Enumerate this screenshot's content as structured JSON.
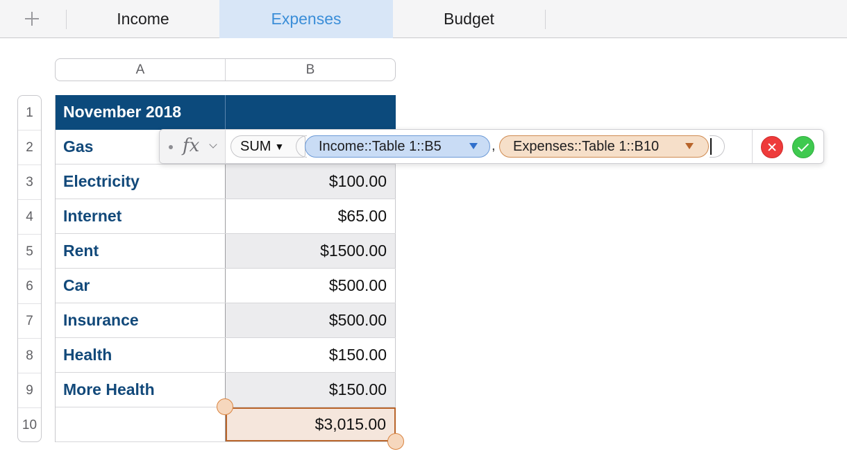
{
  "tabs": {
    "add_icon": "plus-icon",
    "items": [
      {
        "label": "Income",
        "active": false
      },
      {
        "label": "Expenses",
        "active": true
      },
      {
        "label": "Budget",
        "active": false
      }
    ]
  },
  "columns": [
    "A",
    "B"
  ],
  "rows": [
    "1",
    "2",
    "3",
    "4",
    "5",
    "6",
    "7",
    "8",
    "9",
    "10"
  ],
  "table": {
    "header_label": "November 2018",
    "header_value": "",
    "items": [
      {
        "label": "Gas",
        "value": ""
      },
      {
        "label": "Electricity",
        "value": "$100.00"
      },
      {
        "label": "Internet",
        "value": "$65.00"
      },
      {
        "label": "Rent",
        "value": "$1500.00"
      },
      {
        "label": "Car",
        "value": "$500.00"
      },
      {
        "label": "Insurance",
        "value": "$500.00"
      },
      {
        "label": "Health",
        "value": "$150.00"
      },
      {
        "label": "More Health",
        "value": "$150.00"
      }
    ],
    "total_label": "",
    "total_value": "$3,015.00"
  },
  "formula_bar": {
    "fx_label": "fx",
    "function_name": "SUM",
    "args": [
      {
        "ref": "Income::Table 1::B5",
        "color": "#c9dcf5"
      },
      {
        "ref": "Expenses::Table 1::B10",
        "color": "#f6dfc9"
      }
    ],
    "separator": ",",
    "cancel_icon": "cancel-icon",
    "accept_icon": "accept-icon"
  },
  "colors": {
    "header_fill": "#0c4a7c",
    "label_text": "#12497a",
    "active_tab_text": "#3b8ed8",
    "active_tab_fill": "#d8e6f7",
    "selection_border": "#b8642a",
    "selection_fill": "#f5e6dc",
    "cancel_button": "#ee3b3b",
    "accept_button": "#3fc94f"
  }
}
